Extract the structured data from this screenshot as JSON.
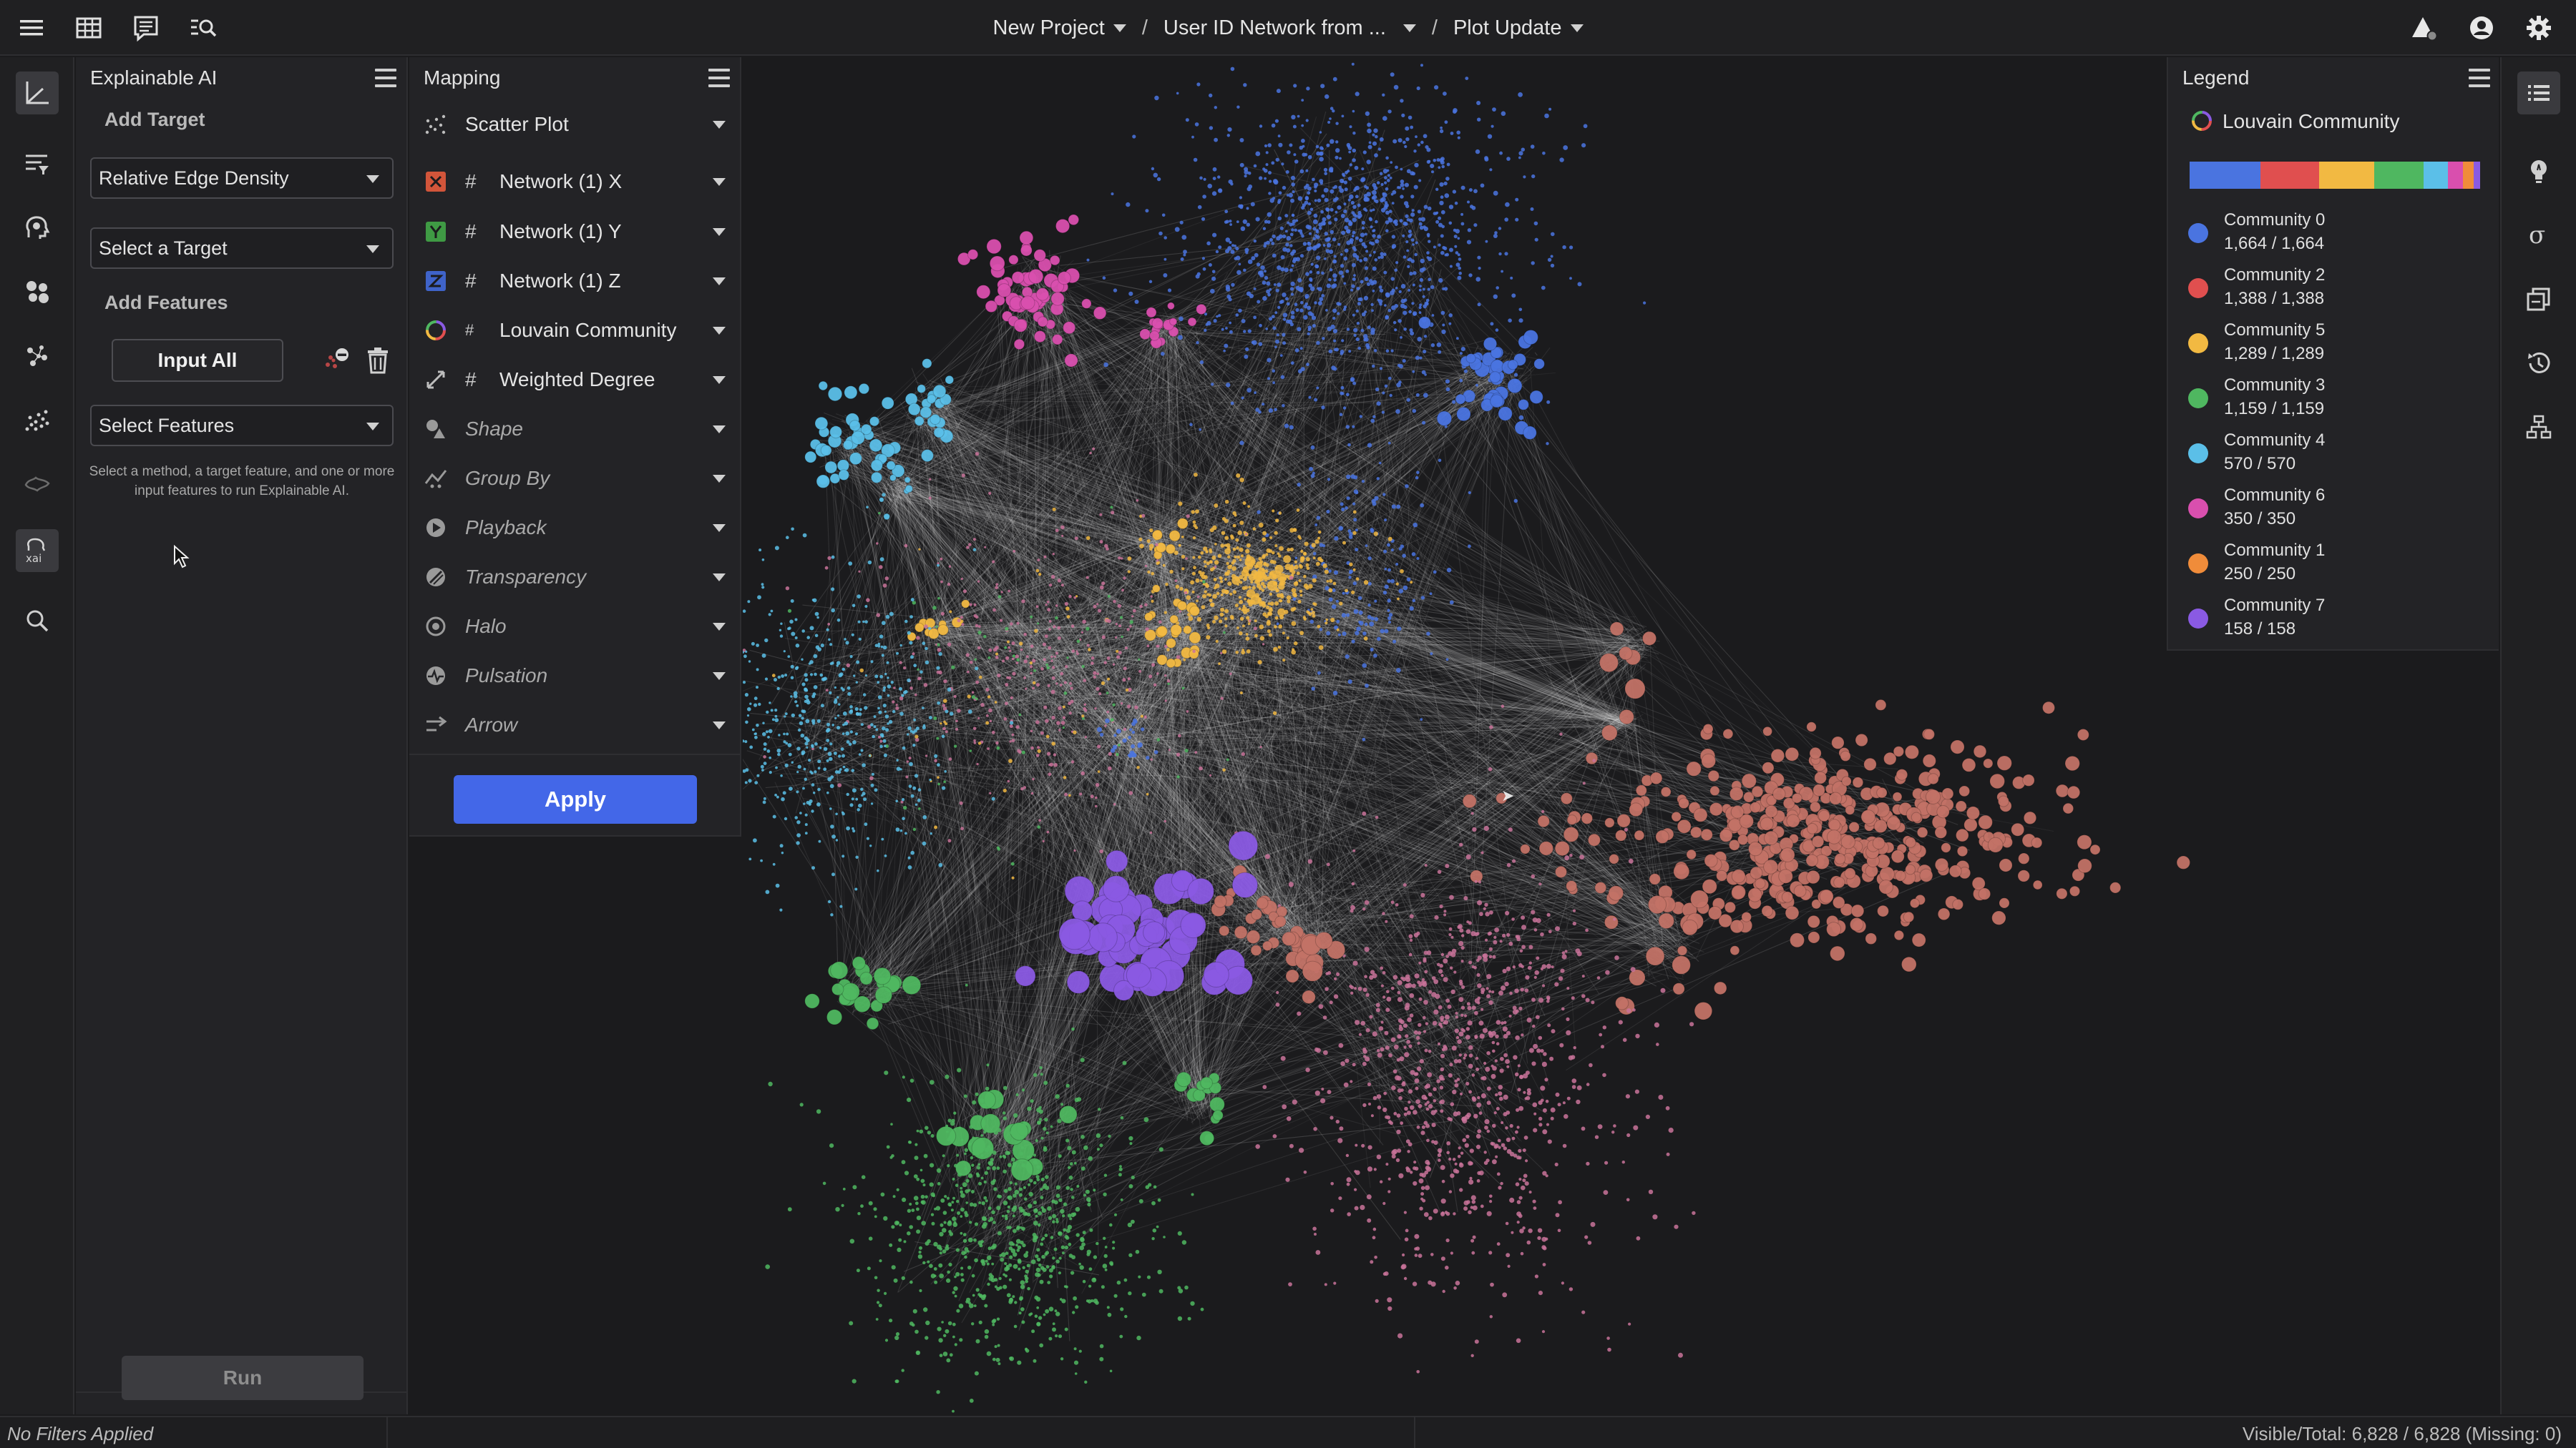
{
  "header": {
    "breadcrumbs": [
      {
        "label": "New Project"
      },
      {
        "label": "User ID Network from ..."
      },
      {
        "label": "Plot Update"
      }
    ],
    "separator": "/"
  },
  "explainable_ai": {
    "title": "Explainable AI",
    "add_target_label": "Add Target",
    "method_value": "Relative Edge Density",
    "target_placeholder": "Select a Target",
    "add_features_label": "Add Features",
    "input_all_label": "Input All",
    "features_placeholder": "Select Features",
    "hint": "Select a method, a target feature, and one or more input features to run Explainable AI.",
    "run_label": "Run"
  },
  "mapping": {
    "title": "Mapping",
    "plot_type": "Scatter Plot",
    "rows": [
      {
        "label": "Network (1) X",
        "hash": "#",
        "axis": "X",
        "color": "#d2553a"
      },
      {
        "label": "Network (1) Y",
        "hash": "#",
        "axis": "Y",
        "color": "#3f9a44"
      },
      {
        "label": "Network (1) Z",
        "hash": "#",
        "axis": "Z",
        "color": "#3f63c9"
      },
      {
        "label": "Louvain Community",
        "hash": "#",
        "icon": "color-wheel-icon"
      },
      {
        "label": "Weighted Degree",
        "hash": "#",
        "icon": "size-icon"
      }
    ],
    "optional_rows": [
      {
        "label": "Shape",
        "icon": "shape-icon"
      },
      {
        "label": "Group By",
        "icon": "group-by-icon"
      },
      {
        "label": "Playback",
        "icon": "playback-icon"
      },
      {
        "label": "Transparency",
        "icon": "transparency-icon"
      },
      {
        "label": "Halo",
        "icon": "halo-icon"
      },
      {
        "label": "Pulsation",
        "icon": "pulsation-icon"
      },
      {
        "label": "Arrow",
        "icon": "arrow-icon"
      }
    ],
    "apply_label": "Apply"
  },
  "legend": {
    "title": "Legend",
    "feature": "Louvain Community",
    "bar_colors": [
      "#4a74e0",
      "#e04f4f",
      "#f2b942",
      "#4fb760",
      "#5bbfe8",
      "#d94fae",
      "#f08c3a",
      "#8a5ae3"
    ],
    "items": [
      {
        "name": "Community 0",
        "count": "1,664 / 1,664",
        "color": "#4a74e0"
      },
      {
        "name": "Community 2",
        "count": "1,388 / 1,388",
        "color": "#e04f4f"
      },
      {
        "name": "Community 5",
        "count": "1,289 / 1,289",
        "color": "#f2b942"
      },
      {
        "name": "Community 3",
        "count": "1,159 / 1,159",
        "color": "#4fb760"
      },
      {
        "name": "Community 4",
        "count": "570 / 570",
        "color": "#5bbfe8"
      },
      {
        "name": "Community 6",
        "count": "350 / 350",
        "color": "#d94fae"
      },
      {
        "name": "Community 1",
        "count": "250 / 250",
        "color": "#f08c3a"
      },
      {
        "name": "Community 7",
        "count": "158 / 158",
        "color": "#8a5ae3"
      }
    ]
  },
  "status": {
    "filters": "No Filters Applied",
    "visible_total": "Visible/Total: 6,828 / 6,828 (Missing: 0)"
  },
  "icons": {
    "top_left": [
      "hamburger-menu-icon",
      "table-icon",
      "notes-icon",
      "search-list-icon"
    ],
    "top_right": [
      "alerts-icon",
      "account-icon",
      "settings-gear-icon"
    ],
    "left_rail": [
      "axes-icon",
      "filter-icon",
      "head-gears-icon",
      "clusters-icon",
      "network-nodes-icon",
      "scatter-icon",
      "map-icon",
      "xai-icon",
      "search-icon"
    ],
    "right_rail": [
      "list-icon",
      "lightbulb-icon",
      "sigma-icon",
      "copy-icon",
      "history-icon",
      "tree-icon"
    ]
  },
  "plot": {
    "clusters": [
      {
        "color": "#4a74e0"
      },
      {
        "color": "#e04f4f"
      },
      {
        "color": "#f2b942"
      },
      {
        "color": "#4fb760"
      },
      {
        "color": "#5bbfe8"
      },
      {
        "color": "#d94fae"
      },
      {
        "color": "#f08c3a"
      },
      {
        "color": "#8a5ae3"
      }
    ]
  }
}
